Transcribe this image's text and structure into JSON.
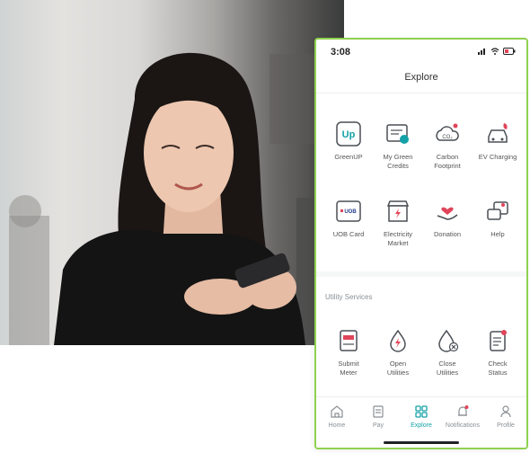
{
  "status": {
    "time": "3:08"
  },
  "header": {
    "title": "Explore"
  },
  "explore_items": [
    {
      "label": "GreenUP",
      "icon": "greenup-icon"
    },
    {
      "label": "My Green\nCredits",
      "icon": "green-credits-icon"
    },
    {
      "label": "Carbon\nFootprint",
      "icon": "carbon-footprint-icon"
    },
    {
      "label": "EV Charging",
      "icon": "ev-charging-icon"
    },
    {
      "label": "UOB Card",
      "icon": "uob-card-icon"
    },
    {
      "label": "Electricity\nMarket",
      "icon": "electricity-market-icon"
    },
    {
      "label": "Donation",
      "icon": "donation-icon"
    },
    {
      "label": "Help",
      "icon": "help-icon"
    }
  ],
  "utility": {
    "title": "Utility Services",
    "items": [
      {
        "label": "Submit\nMeter",
        "icon": "submit-meter-icon"
      },
      {
        "label": "Open\nUtilities",
        "icon": "open-utilities-icon"
      },
      {
        "label": "Close\nUtilities",
        "icon": "close-utilities-icon"
      },
      {
        "label": "Check\nStatus",
        "icon": "check-status-icon"
      }
    ]
  },
  "icon_text": {
    "greenup": "Up",
    "co2": "CO₂",
    "uob": "UOB"
  },
  "tabs": [
    {
      "label": "Home",
      "icon": "home-icon",
      "active": false
    },
    {
      "label": "Pay",
      "icon": "pay-icon",
      "active": false
    },
    {
      "label": "Explore",
      "icon": "explore-icon",
      "active": true
    },
    {
      "label": "Notifications",
      "icon": "bell-icon",
      "active": false
    },
    {
      "label": "Profile",
      "icon": "profile-icon",
      "active": false
    }
  ],
  "colors": {
    "accent": "#14a1a8",
    "phone_border": "#8fd14f",
    "badge": "#e0455a",
    "icon_stroke": "#4a4f55"
  }
}
